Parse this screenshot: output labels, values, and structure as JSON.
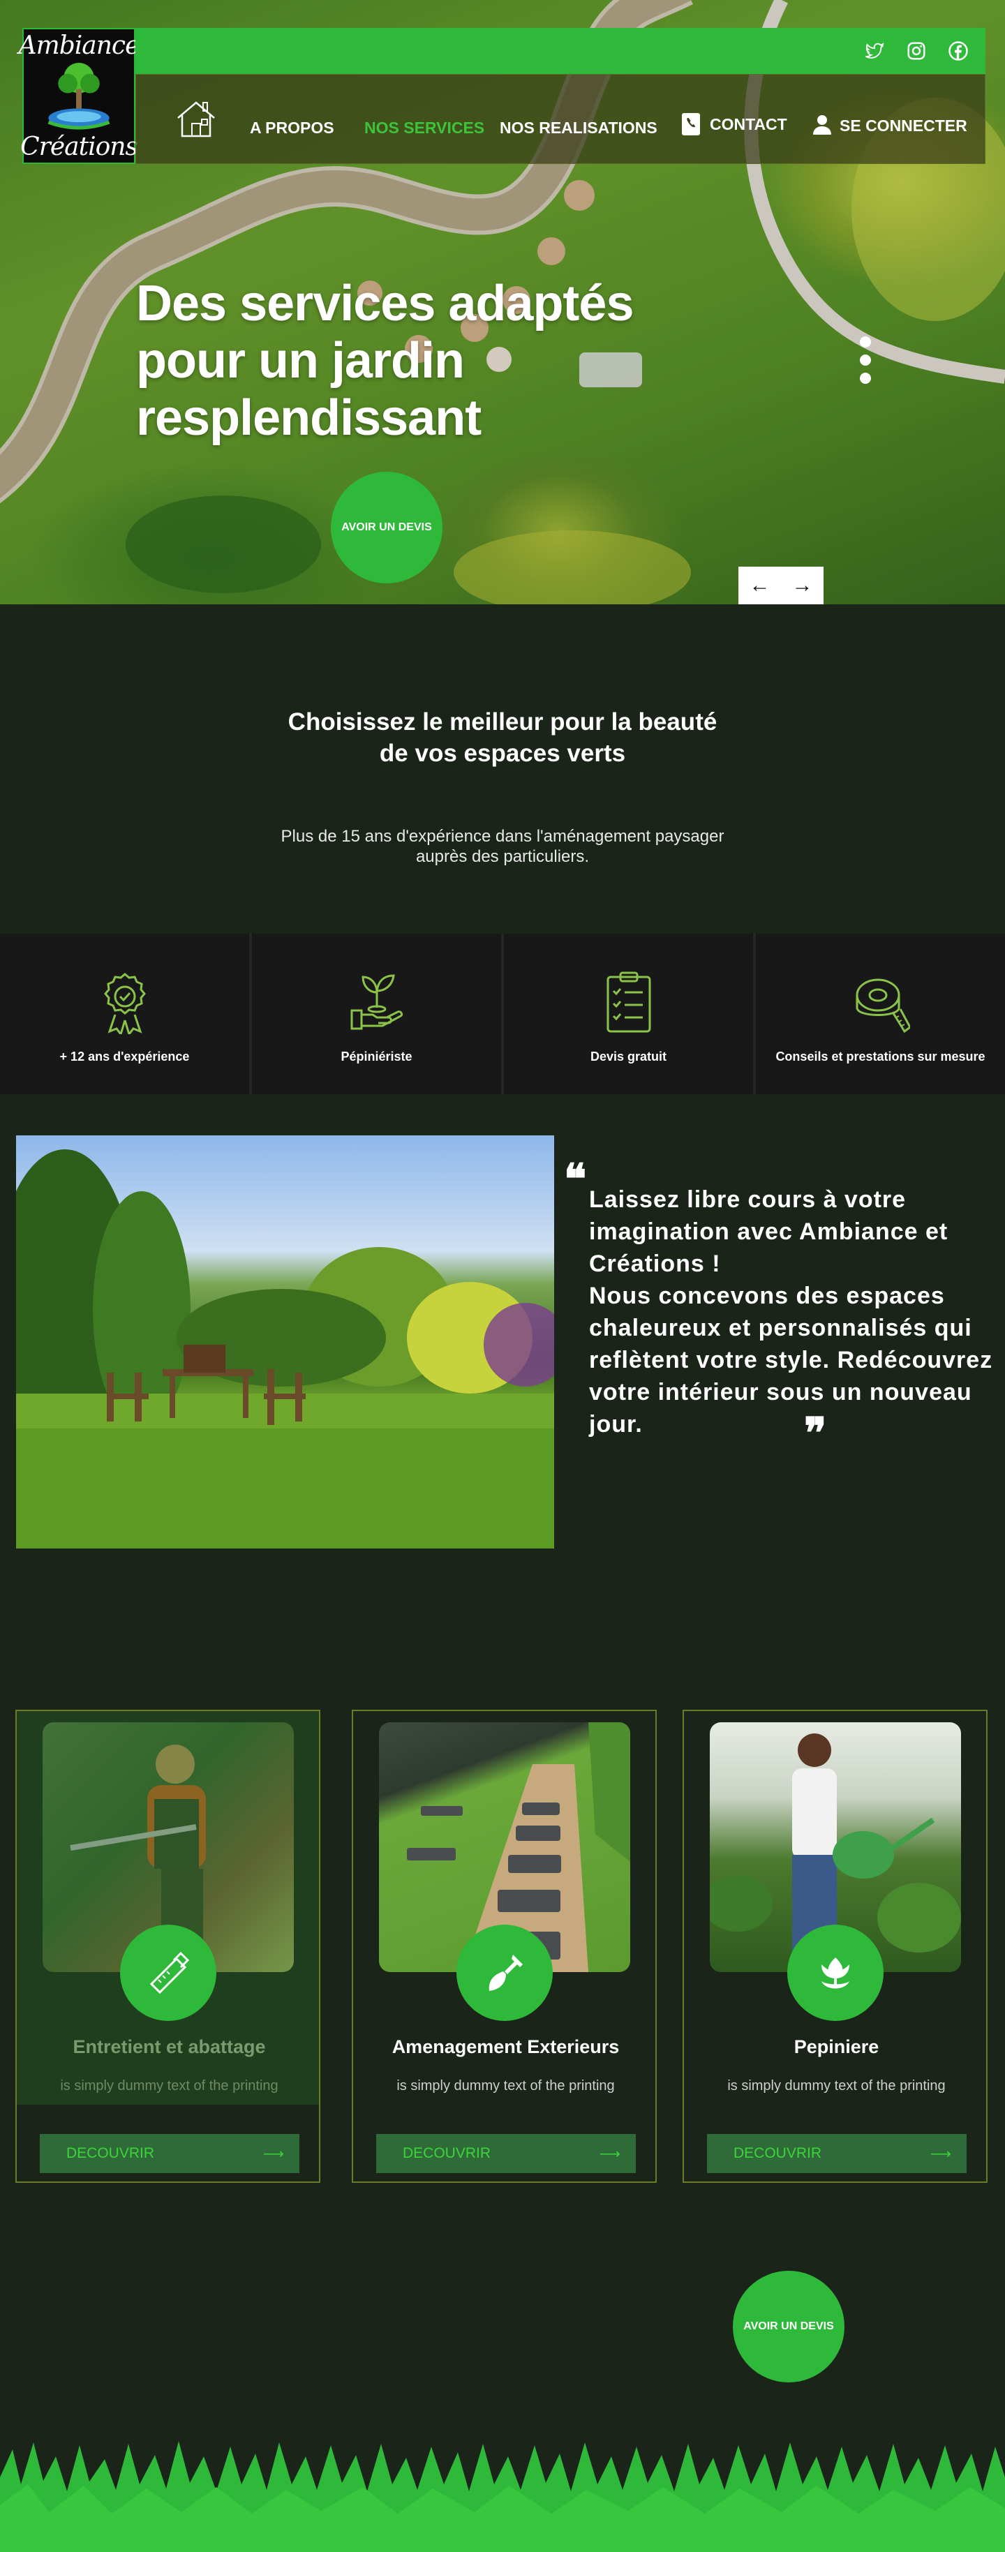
{
  "brand": {
    "logo_top": "Ambiance",
    "logo_bottom": "Créations"
  },
  "topbar": {
    "icons": [
      "twitter-icon",
      "instagram-icon",
      "facebook-icon"
    ]
  },
  "nav": {
    "items": [
      {
        "label": "A PROPOS",
        "active": false
      },
      {
        "label": "NOS SERVICES",
        "active": true
      },
      {
        "label": "NOS REALISATIONS",
        "active": false
      }
    ],
    "contact": "CONTACT",
    "login": "SE CONNECTER"
  },
  "hero": {
    "title": "Des services adaptés pour un jardin resplendissant",
    "cta": "AVOIR UN DEVIS",
    "slides_count": 3
  },
  "intro": {
    "title_line1": "Choisissez le meilleur pour la beauté",
    "title_line2": "de vos espaces verts",
    "subtitle_line1": "Plus de 15 ans d'expérience dans l'aménagement paysager",
    "subtitle_line2": "auprès des particuliers."
  },
  "features": [
    {
      "label": "+ 12 ans d'expérience",
      "icon": "award-ribbon-icon"
    },
    {
      "label": "Pépiniériste",
      "icon": "sprout-hand-icon"
    },
    {
      "label": "Devis gratuit",
      "icon": "checklist-clipboard-icon"
    },
    {
      "label": "Conseils et prestations sur mesure",
      "icon": "measuring-tape-icon"
    }
  ],
  "quote": {
    "text": "Laissez libre cours à votre imagination avec Ambiance et Créations !\n Nous concevons des espaces chaleureux et personnalisés qui reflètent votre style. Redécouvrez votre intérieur sous un nouveau jour."
  },
  "services": [
    {
      "title": "Entretient et  abattage",
      "desc": "is simply dummy text of the printing",
      "button": "DECOUVRIR",
      "icon": "chainsaw-icon"
    },
    {
      "title": "Amenagement Exterieurs",
      "desc": "is simply dummy text of the printing",
      "button": "DECOUVRIR",
      "icon": "shovel-icon"
    },
    {
      "title": "Pepiniere",
      "desc": "is simply dummy text of the printing",
      "button": "DECOUVRIR",
      "icon": "tulip-icon"
    }
  ],
  "bottom_cta": "AVOIR UN DEVIS",
  "colors": {
    "accent": "#2eb93a",
    "background": "#1a2419",
    "nav_active": "#3cc43a",
    "card_border": "#6d7a2a"
  }
}
